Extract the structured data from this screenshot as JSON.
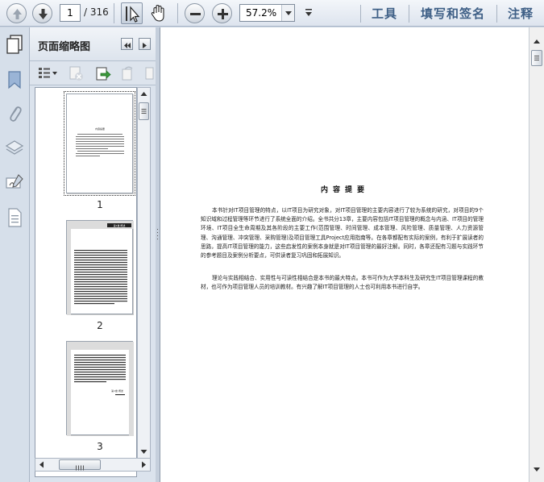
{
  "toolbar": {
    "current_page": "1",
    "total_pages": "/ 316",
    "zoom": "57.2%",
    "links": [
      "工具",
      "填写和签名",
      "注释"
    ]
  },
  "panel": {
    "title": "页面缩略图",
    "thumbnails": [
      {
        "page_label": "1",
        "heading": "内容提要"
      },
      {
        "page_label": "2",
        "heading": "第1章 概述"
      },
      {
        "page_label": "3",
        "heading": "第1章 概述"
      }
    ]
  },
  "document": {
    "title": "内容提要",
    "paragraphs": [
      "本书针对IT项目管理的特点，以IT项目为研究对象，对IT项目管理的主要内容进行了较为系统的研究，对项目的9个知识域和过程管理等环节进行了系统全面的介绍。全书共分13章，主要内容包括IT项目管理的概念与内涵、IT项目的管理环境、IT项目全生命周期及其各阶段的主要工作(范围管理、时间管理、成本管理、风险管理、质量管理、人力资源管理、沟通管理、冲突管理、采购管理)及项目管理工具Project应用指南等。在各章都配有实际的案例，有利于扩展读者的思路，提高IT项目管理的能力，这些启发性的案例本身就是对IT项目管理的最好注解。同时，各章还配有习题与实践环节的参考题目及案例分析要点，可供读者复习巩固和拓展知识。",
      "理论与实践相结合、实用性与可读性相结合是本书的最大特点。本书可作为大学本科生及研究生IT项目管理课程的教材，也可作为项目管理人员的培训教材。有兴趣了解IT项目管理的人士也可利用本书进行自学。"
    ]
  },
  "colors": {
    "link": "#3e5f86",
    "toolbar_bg": "#e6ebf2",
    "panel_bg": "#dbe3ed"
  }
}
